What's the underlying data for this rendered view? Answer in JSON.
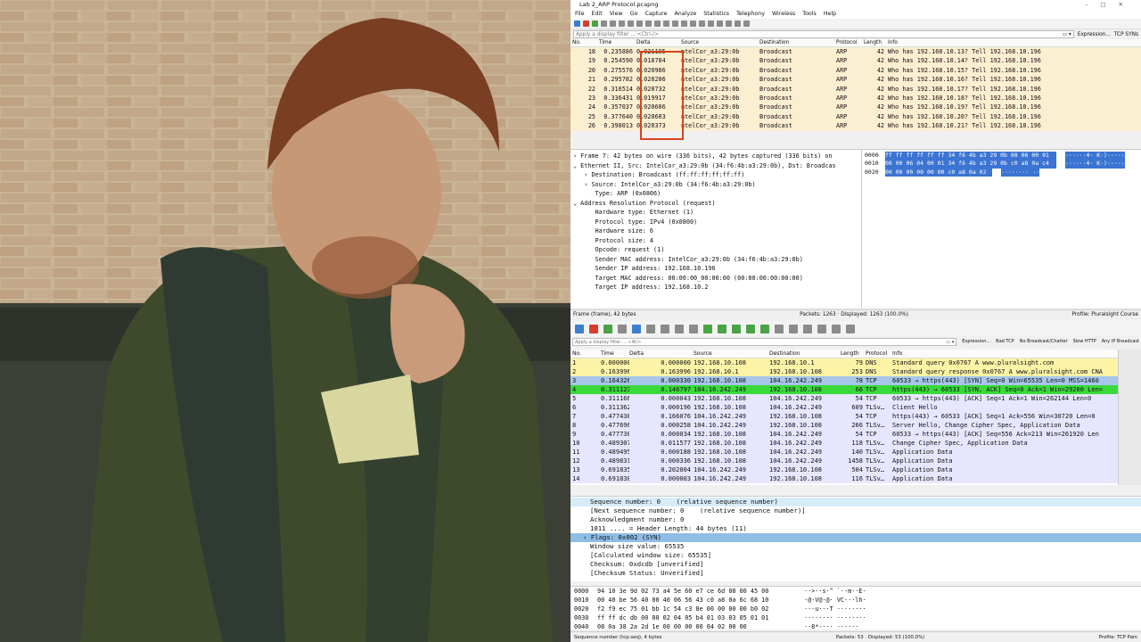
{
  "window": {
    "title": "Lab 2_ARP Protocol.pcapng"
  },
  "menu": [
    "File",
    "Edit",
    "View",
    "Go",
    "Capture",
    "Analyze",
    "Statistics",
    "Telephony",
    "Wireless",
    "Tools",
    "Help"
  ],
  "filter1": {
    "placeholder": "Apply a display filter ... <Ctrl-/>",
    "expression": "Expression...",
    "button": "TCP SYNs"
  },
  "list1": {
    "columns": [
      "No.",
      "Time",
      "Delta",
      "Source",
      "Destination",
      "Protocol",
      "Length",
      "Info"
    ],
    "rows": [
      [
        "18",
        "0.235886",
        "0.021185",
        "ntelCor_a3:29:0b",
        "Broadcast",
        "ARP",
        "42",
        "Who has 192.168.10.13? Tell 192.168.10.196"
      ],
      [
        "19",
        "0.254590",
        "0.018704",
        "ntelCor_a3:29:0b",
        "Broadcast",
        "ARP",
        "42",
        "Who has 192.168.10.14? Tell 192.168.10.196"
      ],
      [
        "20",
        "0.275576",
        "0.020986",
        "ntelCor_a3:29:0b",
        "Broadcast",
        "ARP",
        "42",
        "Who has 192.168.10.15? Tell 192.168.10.196"
      ],
      [
        "21",
        "0.295782",
        "0.020206",
        "ntelCor_a3:29:0b",
        "Broadcast",
        "ARP",
        "42",
        "Who has 192.168.10.16? Tell 192.168.10.196"
      ],
      [
        "22",
        "0.316514",
        "0.020732",
        "ntelCor_a3:29:0b",
        "Broadcast",
        "ARP",
        "42",
        "Who has 192.168.10.17? Tell 192.168.10.196"
      ],
      [
        "23",
        "0.336431",
        "0.019917",
        "ntelCor_a3:29:0b",
        "Broadcast",
        "ARP",
        "42",
        "Who has 192.168.10.18? Tell 192.168.10.196"
      ],
      [
        "24",
        "0.357037",
        "0.020606",
        "ntelCor_a3:29:0b",
        "Broadcast",
        "ARP",
        "42",
        "Who has 192.168.10.19? Tell 192.168.10.196"
      ],
      [
        "25",
        "0.377640",
        "0.020603",
        "ntelCor_a3:29:0b",
        "Broadcast",
        "ARP",
        "42",
        "Who has 192.168.10.20? Tell 192.168.10.196"
      ],
      [
        "26",
        "0.398013",
        "0.020373",
        "ntelCor_a3:29:0b",
        "Broadcast",
        "ARP",
        "42",
        "Who has 192.168.10.21? Tell 192.168.10.196"
      ]
    ]
  },
  "tree1": [
    "› Frame 7: 42 bytes on wire (336 bits), 42 bytes captured (336 bits) on",
    "⌄ Ethernet II, Src: IntelCor_a3:29:0b (34:f6:4b:a3:29:0b), Dst: Broadcas",
    "   › Destination: Broadcast (ff:ff:ff:ff:ff:ff)",
    "   › Source: IntelCor_a3:29:0b (34:f6:4b:a3:29:0b)",
    "      Type: ARP (0x0806)",
    "⌄ Address Resolution Protocol (request)",
    "      Hardware type: Ethernet (1)",
    "      Protocol type: IPv4 (0x0800)",
    "      Hardware size: 6",
    "      Protocol size: 4",
    "      Opcode: request (1)",
    "      Sender MAC address: IntelCor_a3:29:0b (34:f6:4b:a3:29:0b)",
    "      Sender IP address: 192.168.10.196",
    "      Target MAC address: 00:00:00_00:00:00 (00:00:00:00:00:00)",
    "      Target IP address: 192.168.10.2"
  ],
  "hex1": [
    {
      "off": "0000",
      "bytes": "ff ff ff ff ff ff 34 f6  4b a3 29 0b 08 06 00 01",
      "ascii": "······4· K·)·····"
    },
    {
      "off": "0010",
      "bytes": "08 00 06 04 00 01 34 f6  4b a3 29 0b c0 a8 0a c4",
      "ascii": "······4· K·)·····"
    },
    {
      "off": "0020",
      "bytes": "00 00 00 00 00 00 c0 a8  0a 02",
      "ascii": "········ ··"
    }
  ],
  "status1": {
    "left": "Frame (frame), 42 bytes",
    "middle": "Packets: 1263 · Displayed: 1263 (100.0%)",
    "right": "Profile: Pluralsight Course"
  },
  "filter2": {
    "placeholder": "Apply a display filter ... <⌘/>",
    "expression": "Expression...",
    "buttons": [
      "Bad TCP",
      "No Broadcast/Chatter",
      "Slow HTTP",
      "Any IP Broadcast"
    ]
  },
  "list2": {
    "columns": [
      "No.",
      "Time",
      "Delta",
      "Source",
      "Destination",
      "Length",
      "Protocol",
      "Info"
    ],
    "rows": [
      {
        "c": [
          "1",
          "0.000000",
          "0.000000",
          "192.168.10.108",
          "192.168.10.1",
          "79",
          "DNS",
          "Standard query 0x0767 A www.pluralsight.com"
        ],
        "bg": "#fdf3a7"
      },
      {
        "c": [
          "2",
          "0.163996",
          "0.163996",
          "192.168.10.1",
          "192.168.10.108",
          "253",
          "DNS",
          "Standard query response 0x0767 A www.pluralsight.com CNA"
        ],
        "bg": "#fdf3a7"
      },
      {
        "c": [
          "3",
          "0.164326",
          "0.000330",
          "192.168.10.108",
          "104.16.242.249",
          "78",
          "TCP",
          "60533 → https(443) [SYN] Seq=0 Win=65535 Len=0 MSS=1460"
        ],
        "bg": "#a7c6ea"
      },
      {
        "c": [
          "4",
          "0.311123",
          "0.146797",
          "104.16.242.249",
          "192.168.10.108",
          "66",
          "TCP",
          "https(443) → 60533 [SYN, ACK] Seq=0 Ack=1 Win=29200 Len="
        ],
        "bg": "#3ad93a"
      },
      {
        "c": [
          "5",
          "0.311166",
          "0.000043",
          "192.168.10.108",
          "104.16.242.249",
          "54",
          "TCP",
          "60533 → https(443) [ACK] Seq=1 Ack=1 Win=262144 Len=0"
        ],
        "bg": "#e7e6ff"
      },
      {
        "c": [
          "6",
          "0.311362",
          "0.000196",
          "192.168.10.108",
          "104.16.242.249",
          "609",
          "TLSv…",
          "Client Hello"
        ],
        "bg": "#e7e6ff"
      },
      {
        "c": [
          "7",
          "0.477438",
          "0.166076",
          "104.16.242.249",
          "192.168.10.108",
          "54",
          "TCP",
          "https(443) → 60533 [ACK] Seq=1 Ack=556 Win=30720 Len=0"
        ],
        "bg": "#e7e6ff"
      },
      {
        "c": [
          "8",
          "0.477696",
          "0.000258",
          "104.16.242.249",
          "192.168.10.108",
          "266",
          "TLSv…",
          "Server Hello, Change Cipher Spec, Application Data"
        ],
        "bg": "#e7e6ff"
      },
      {
        "c": [
          "9",
          "0.477730",
          "0.000034",
          "192.168.10.108",
          "104.16.242.249",
          "54",
          "TCP",
          "60533 → https(443) [ACK] Seq=556 Ack=213 Win=261920 Len"
        ],
        "bg": "#e7e6ff"
      },
      {
        "c": [
          "10",
          "0.489307",
          "0.011577",
          "192.168.10.108",
          "104.16.242.249",
          "118",
          "TLSv…",
          "Change Cipher Spec, Application Data"
        ],
        "bg": "#e7e6ff"
      },
      {
        "c": [
          "11",
          "0.489495",
          "0.000188",
          "192.168.10.108",
          "104.16.242.249",
          "140",
          "TLSv…",
          "Application Data"
        ],
        "bg": "#e7e6ff"
      },
      {
        "c": [
          "12",
          "0.489831",
          "0.000336",
          "192.168.10.108",
          "104.16.242.249",
          "1458",
          "TLSv…",
          "Application Data"
        ],
        "bg": "#e7e6ff"
      },
      {
        "c": [
          "13",
          "0.691835",
          "0.202004",
          "104.16.242.249",
          "192.168.10.108",
          "504",
          "TLSv…",
          "Application Data"
        ],
        "bg": "#e7e6ff"
      },
      {
        "c": [
          "14",
          "0.691838",
          "0.000003",
          "104.16.242.249",
          "192.168.10.108",
          "116",
          "TLSv…",
          "Application Data"
        ],
        "bg": "#e7e6ff"
      }
    ]
  },
  "tree2": [
    "Sequence number: 0    (relative sequence number)",
    "[Next sequence number: 0    (relative sequence number)]",
    "Acknowledgment number: 0",
    "1011 .... = Header Length: 44 bytes (11)",
    "› Flags: 0x002 (SYN)",
    "Window size value: 65535",
    "[Calculated window size: 65535]",
    "Checksum: 0xdcdb [unverified]",
    "[Checksum Status: Unverified]"
  ],
  "hex2": [
    {
      "off": "0000",
      "bytes": "94 10 3e 9d 02 73 a4 5e  60 e7 ce 6d 08 00 45 00",
      "ascii": "··>··s·^ `··m··E·"
    },
    {
      "off": "0010",
      "bytes": "00 40 be 56 40 00 40 06  56 43 c0 a8 0a 6c 68 10",
      "ascii": "·@·V@·@· VC···lh·"
    },
    {
      "off": "0020",
      "bytes": "f2 f9 ec 75 01 bb 1c 54  c3 8e 00 00 00 00 b0 02",
      "ascii": "···u···T ········"
    },
    {
      "off": "0030",
      "bytes": "ff ff dc db 00 00 02 04  05 b4 01 03 03 05 01 01",
      "ascii": "········ ········"
    },
    {
      "off": "0040",
      "bytes": "08 0a 38 2a 2d 1e 00 00  00 00 04 02 00 00",
      "ascii": "··8*-··· ······"
    }
  ],
  "status2": {
    "left": "Sequence number (tcp.seq), 4 bytes",
    "middle": "Packets: 53 · Displayed: 53 (100.0%)",
    "right": "Profile: TCP Pain"
  },
  "colors": {
    "arp_row": "#fbefd2",
    "highlight": "#d9441c",
    "selection": "#3b74d2"
  }
}
